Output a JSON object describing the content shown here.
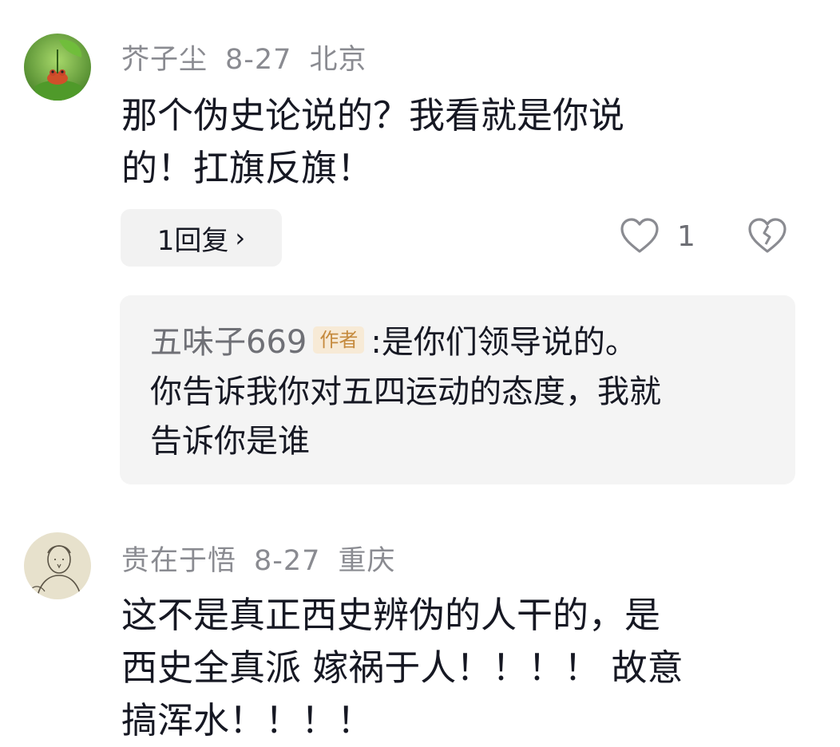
{
  "comments": [
    {
      "username": "芥子尘",
      "date": "8-27",
      "location": "北京",
      "text_lines": [
        "那个伪史论说的？我看就是你说",
        "的！扛旗反旗！"
      ],
      "reply_button_label": "1回复",
      "reply_chevron": "›",
      "like_count": "1",
      "avatar_icon": "frog-on-leaf-avatar",
      "reply": {
        "username": "五味子669",
        "badge": "作者",
        "text_lines": [
          ":是你们领导说的。",
          "你告诉我你对五四运动的态度，我就",
          "告诉你是谁"
        ]
      }
    },
    {
      "username": "贵在于悟",
      "date": "8-27",
      "location": "重庆",
      "text_lines": [
        "这不是真正西史辨伪的人干的，是",
        "西史全真派 嫁祸于人！！！！ 故意",
        "搞浑水！！！！"
      ],
      "avatar_icon": "sketch-portrait-avatar"
    }
  ],
  "colors": {
    "meta": "#8a8b91",
    "text": "#161823",
    "author_badge_bg": "#f7ead6",
    "author_badge_text": "#c58a3d",
    "reply_bg": "#f4f4f4"
  }
}
